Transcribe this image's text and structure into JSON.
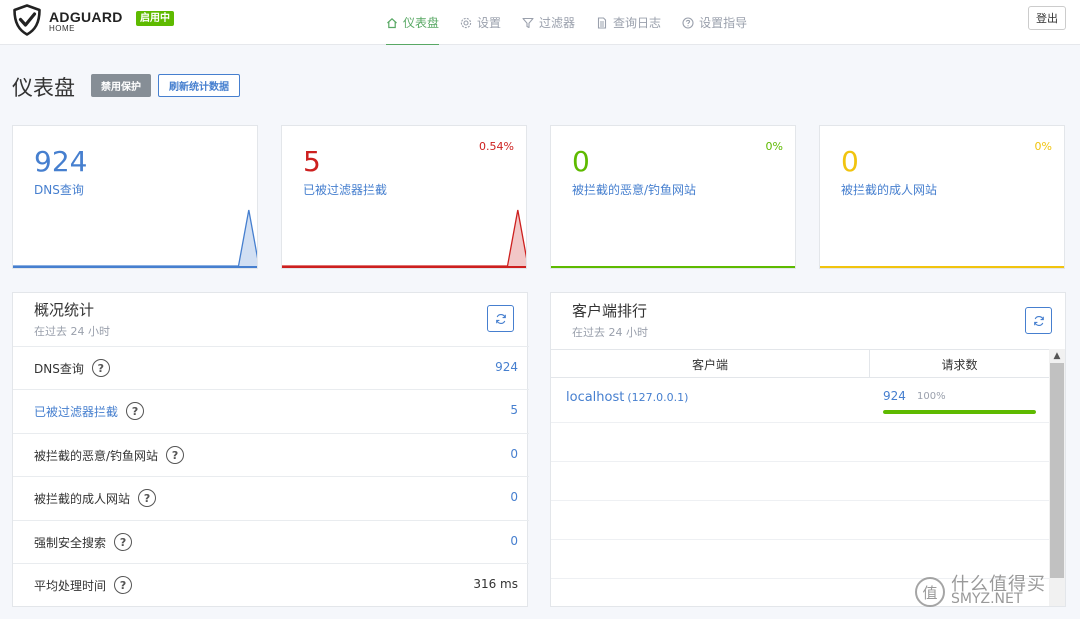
{
  "header": {
    "logo_main": "ADGUARD",
    "logo_sub": "HOME",
    "status_badge": "启用中",
    "nav": [
      {
        "label": "仪表盘",
        "icon": "home-icon",
        "active": true
      },
      {
        "label": "设置",
        "icon": "gear-icon",
        "active": false
      },
      {
        "label": "过滤器",
        "icon": "filter-icon",
        "active": false
      },
      {
        "label": "查询日志",
        "icon": "document-icon",
        "active": false
      },
      {
        "label": "设置指导",
        "icon": "help-circle-icon",
        "active": false
      }
    ],
    "logout": "登出"
  },
  "page": {
    "title": "仪表盘",
    "disable_button": "禁用保护",
    "refresh_button": "刷新统计数据"
  },
  "cards": [
    {
      "value": "924",
      "label": "DNS查询",
      "percent": "",
      "color": "#467fcf",
      "spark": [
        0,
        0,
        0,
        0,
        0,
        0,
        0,
        0,
        0,
        0,
        0,
        0,
        0,
        0,
        0,
        0,
        0,
        0,
        0,
        0,
        0,
        0,
        0,
        924,
        0
      ]
    },
    {
      "value": "5",
      "label": "已被过滤器拦截",
      "percent": "0.54%",
      "color": "#cd201f",
      "spark": [
        0,
        0,
        0,
        0,
        0,
        0,
        0,
        0,
        0,
        0,
        0,
        0,
        0,
        0,
        0,
        0,
        0,
        0,
        0,
        0,
        0,
        0,
        0,
        5,
        0
      ]
    },
    {
      "value": "0",
      "label": "被拦截的恶意/钓鱼网站",
      "percent": "0%",
      "color": "#5eba00",
      "spark": []
    },
    {
      "value": "0",
      "label": "被拦截的成人网站",
      "percent": "0%",
      "color": "#f1c40f",
      "spark": []
    }
  ],
  "overview": {
    "title": "概况统计",
    "subtitle": "在过去 24 小时",
    "rows": [
      {
        "label": "DNS查询",
        "value": "924",
        "label_blue": false,
        "value_dark": false
      },
      {
        "label": "已被过滤器拦截",
        "value": "5",
        "label_blue": true,
        "value_dark": false
      },
      {
        "label": "被拦截的恶意/钓鱼网站",
        "value": "0",
        "label_blue": false,
        "value_dark": false
      },
      {
        "label": "被拦截的成人网站",
        "value": "0",
        "label_blue": false,
        "value_dark": false
      },
      {
        "label": "强制安全搜索",
        "value": "0",
        "label_blue": false,
        "value_dark": false
      },
      {
        "label": "平均处理时间",
        "value": "316 ms",
        "label_blue": false,
        "value_dark": true
      }
    ]
  },
  "clients": {
    "title": "客户端排行",
    "subtitle": "在过去 24 小时",
    "col_client": "客户端",
    "col_requests": "请求数",
    "rows": [
      {
        "name": "localhost",
        "ip": "(127.0.0.1)",
        "count": "924",
        "percent": "100%",
        "fraction": 1.0
      }
    ]
  },
  "watermark": {
    "glyph": "值",
    "text_top": "什么值得买",
    "text_bottom": "SMYZ.NET"
  }
}
